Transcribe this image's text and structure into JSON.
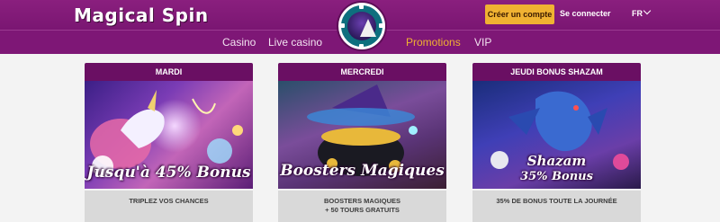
{
  "brand": {
    "logo": "Magical Spin",
    "accent": "#f0b232",
    "primary": "#7a1672"
  },
  "header": {
    "create_account": "Créer un compte",
    "login": "Se connecter",
    "language": "FR"
  },
  "nav": {
    "items": [
      {
        "label": "Casino"
      },
      {
        "label": "Live casino"
      },
      {
        "label": "Promotions",
        "active": true
      },
      {
        "label": "VIP"
      }
    ]
  },
  "cards": [
    {
      "day": "MARDI",
      "banner": "Jusqu'à 45% Bonus",
      "description": "TRIPLEZ VOS CHANCES"
    },
    {
      "day": "MERCREDI",
      "banner": "Boosters Magiques",
      "description_line1": "BOOSTERS MAGIQUES",
      "description_line2": "+ 50 TOURS GRATUITS"
    },
    {
      "day": "JEUDI BONUS SHAZAM",
      "banner_line1": "Shazam",
      "banner_line2": "35% Bonus",
      "description": "35% DE BONUS TOUTE LA JOURNÉE"
    }
  ]
}
